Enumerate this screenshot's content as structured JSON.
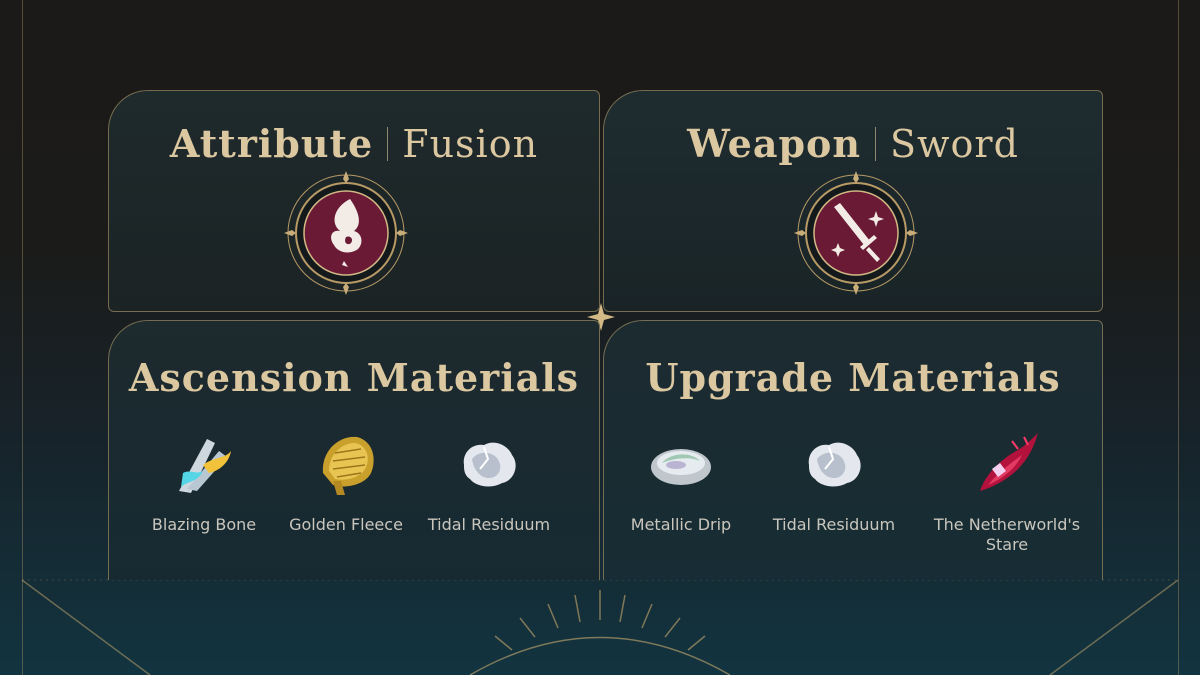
{
  "attribute": {
    "title": "Attribute",
    "value": "Fusion",
    "emblem_icon": "fusion-flame-icon"
  },
  "weapon": {
    "title": "Weapon",
    "value": "Sword",
    "emblem_icon": "sword-icon"
  },
  "ascension": {
    "title": "Ascension Materials",
    "items": [
      {
        "name": "Blazing Bone",
        "icon": "blazing-bone-icon"
      },
      {
        "name": "Golden Fleece",
        "icon": "golden-fleece-icon"
      },
      {
        "name": "Tidal Residuum",
        "icon": "tidal-residuum-icon"
      }
    ]
  },
  "upgrade": {
    "title": "Upgrade Materials",
    "items": [
      {
        "name": "Metallic Drip",
        "icon": "metallic-drip-icon"
      },
      {
        "name": "Tidal Residuum",
        "icon": "tidal-residuum-icon"
      },
      {
        "name": "The Netherworld's Stare",
        "icon": "netherworld-stare-icon"
      }
    ]
  },
  "colors": {
    "gold": "#dbc7a0",
    "emblem_fill": "#6b1a35",
    "label": "#c9c6bd"
  }
}
